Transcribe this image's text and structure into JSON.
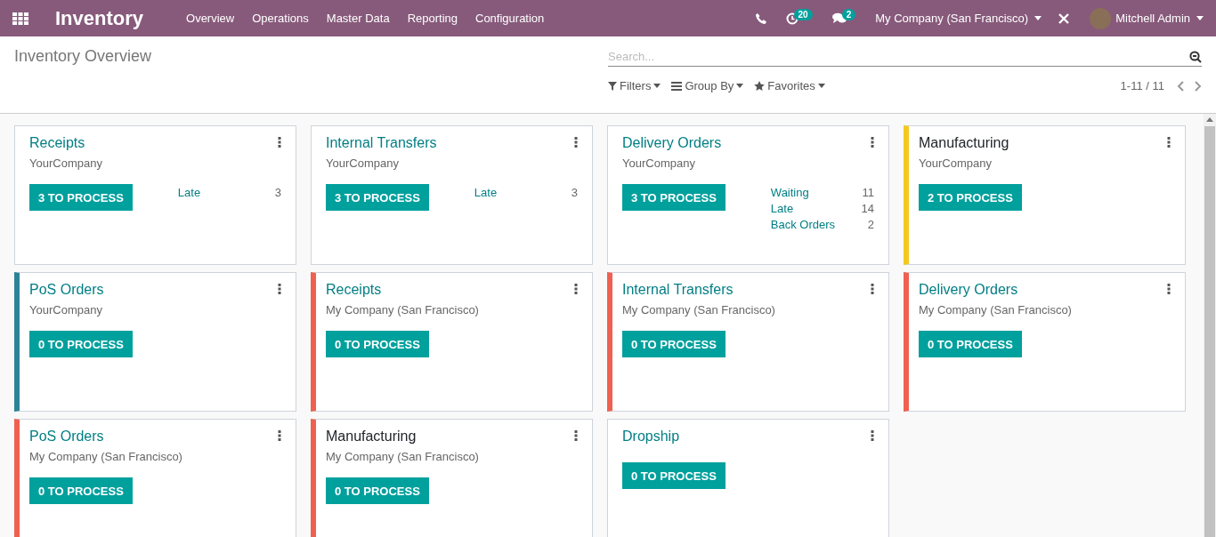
{
  "navbar": {
    "app_title": "Inventory",
    "menu": [
      "Overview",
      "Operations",
      "Master Data",
      "Reporting",
      "Configuration"
    ],
    "activity_count": "20",
    "message_count": "2",
    "company": "My Company (San Francisco)",
    "user": "Mitchell Admin"
  },
  "control_panel": {
    "title": "Inventory Overview",
    "search": {
      "placeholder": "Search..."
    },
    "filters": [
      "Filters",
      "Group By",
      "Favorites"
    ],
    "pager": "1-11 / 11"
  },
  "cards": [
    {
      "title": "Receipts",
      "title_linked": true,
      "company": "YourCompany",
      "button": "3 TO PROCESS",
      "stats": [
        {
          "label": "Late",
          "value": "3"
        }
      ]
    },
    {
      "title": "Internal Transfers",
      "title_linked": true,
      "company": "YourCompany",
      "button": "3 TO PROCESS",
      "stats": [
        {
          "label": "Late",
          "value": "3"
        }
      ]
    },
    {
      "title": "Delivery Orders",
      "title_linked": true,
      "company": "YourCompany",
      "button": "3 TO PROCESS",
      "stats": [
        {
          "label": "Waiting",
          "value": "11"
        },
        {
          "label": "Late",
          "value": "14"
        },
        {
          "label": "Back Orders",
          "value": "2"
        }
      ]
    },
    {
      "title": "Manufacturing",
      "title_linked": false,
      "company": "YourCompany",
      "button": "2 TO PROCESS",
      "color": "#f4c81f"
    },
    {
      "title": "PoS Orders",
      "title_linked": true,
      "company": "YourCompany",
      "button": "0 TO PROCESS",
      "color": "#2c8397"
    },
    {
      "title": "Receipts",
      "title_linked": true,
      "company": "My Company (San Francisco)",
      "button": "0 TO PROCESS",
      "color": "#f06050"
    },
    {
      "title": "Internal Transfers",
      "title_linked": true,
      "company": "My Company (San Francisco)",
      "button": "0 TO PROCESS",
      "color": "#f06050"
    },
    {
      "title": "Delivery Orders",
      "title_linked": true,
      "company": "My Company (San Francisco)",
      "button": "0 TO PROCESS",
      "color": "#f06050"
    },
    {
      "title": "PoS Orders",
      "title_linked": true,
      "company": "My Company (San Francisco)",
      "button": "0 TO PROCESS",
      "color": "#f06050"
    },
    {
      "title": "Manufacturing",
      "title_linked": false,
      "company": "My Company (San Francisco)",
      "button": "0 TO PROCESS",
      "color": "#f06050"
    },
    {
      "title": "Dropship",
      "title_linked": true,
      "button": "0 TO PROCESS"
    }
  ]
}
